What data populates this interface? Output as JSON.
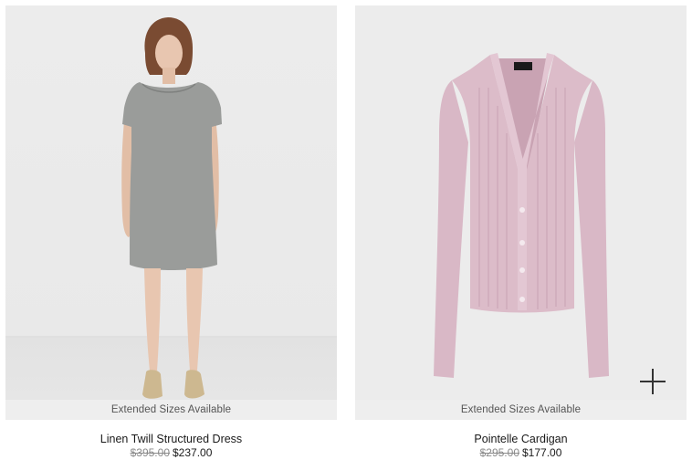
{
  "products": [
    {
      "name": "Linen Twill Structured Dress",
      "original_price": "$395.00",
      "sale_price": "$237.00",
      "badge": "Extended Sizes Available"
    },
    {
      "name": "Pointelle Cardigan",
      "original_price": "$295.00",
      "sale_price": "$177.00",
      "badge": "Extended Sizes Available"
    }
  ],
  "colors": {
    "dress": "#9a9c9a",
    "cardigan": "#d9b8c6",
    "badge_bg": "#eeeeee",
    "strike_price": "#8a8a8a"
  },
  "icons": {
    "quick_add": "plus-icon"
  }
}
